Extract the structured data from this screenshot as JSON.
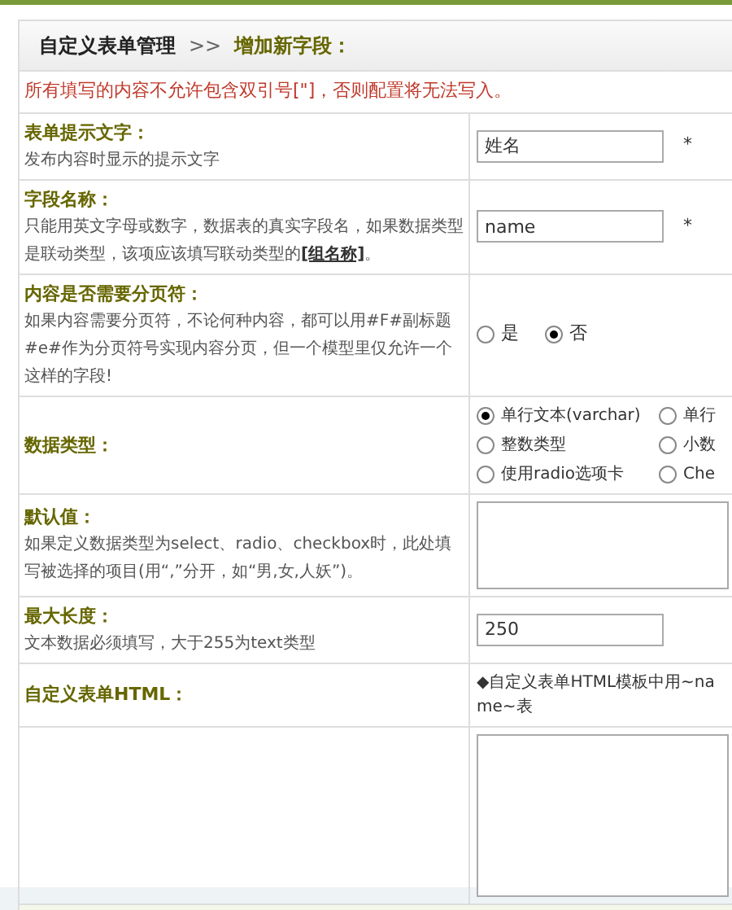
{
  "breadcrumb": {
    "root": "自定义表单管理",
    "separator": ">>",
    "current": "增加新字段："
  },
  "notice": "所有填写的内容不允许包含双引号[\"]，否则配置将无法写入。",
  "rows": [
    {
      "kind": "text",
      "label": "表单提示文字：",
      "description": "发布内容时显示的提示文字",
      "value": "姓名",
      "required_mark": "*"
    },
    {
      "kind": "text",
      "label": "字段名称：",
      "description": "只能用英文字母或数字，数据表的真实字段名，如果数据类型是联动类型，该项应该填写联动类型的",
      "link": "[组名称]",
      "description_after": "。",
      "value": "name",
      "required_mark": "*"
    },
    {
      "kind": "radio",
      "label": "内容是否需要分页符：",
      "description": "如果内容需要分页符，不论何种内容，都可以用#F#副标题#e#作为分页符号实现内容分页，但一个模型里仅允许一个这样的字段!",
      "options": [
        {
          "label": "是",
          "selected": false
        },
        {
          "label": "否",
          "selected": true
        }
      ]
    },
    {
      "kind": "radio_grid",
      "label": "数据类型：",
      "options": [
        {
          "label": "单行文本(varchar)",
          "selected": true
        },
        {
          "label": "单行",
          "selected": false
        },
        {
          "label": "整数类型",
          "selected": false
        },
        {
          "label": "小数",
          "selected": false
        },
        {
          "label": "使用radio选项卡",
          "selected": false
        },
        {
          "label": "Che",
          "selected": false
        }
      ]
    },
    {
      "kind": "textarea",
      "label": "默认值：",
      "description": "如果定义数据类型为select、radio、checkbox时，此处填写被选择的项目(用“,”分开，如“男,女,人妖”)。"
    },
    {
      "kind": "text",
      "label": "最大长度：",
      "description": "文本数据必须填写，大于255为text类型",
      "value": "250"
    },
    {
      "kind": "note",
      "label": "自定义表单HTML：",
      "note": "◆自定义表单HTML模板中用~name~表"
    },
    {
      "kind": "big_textarea"
    }
  ]
}
